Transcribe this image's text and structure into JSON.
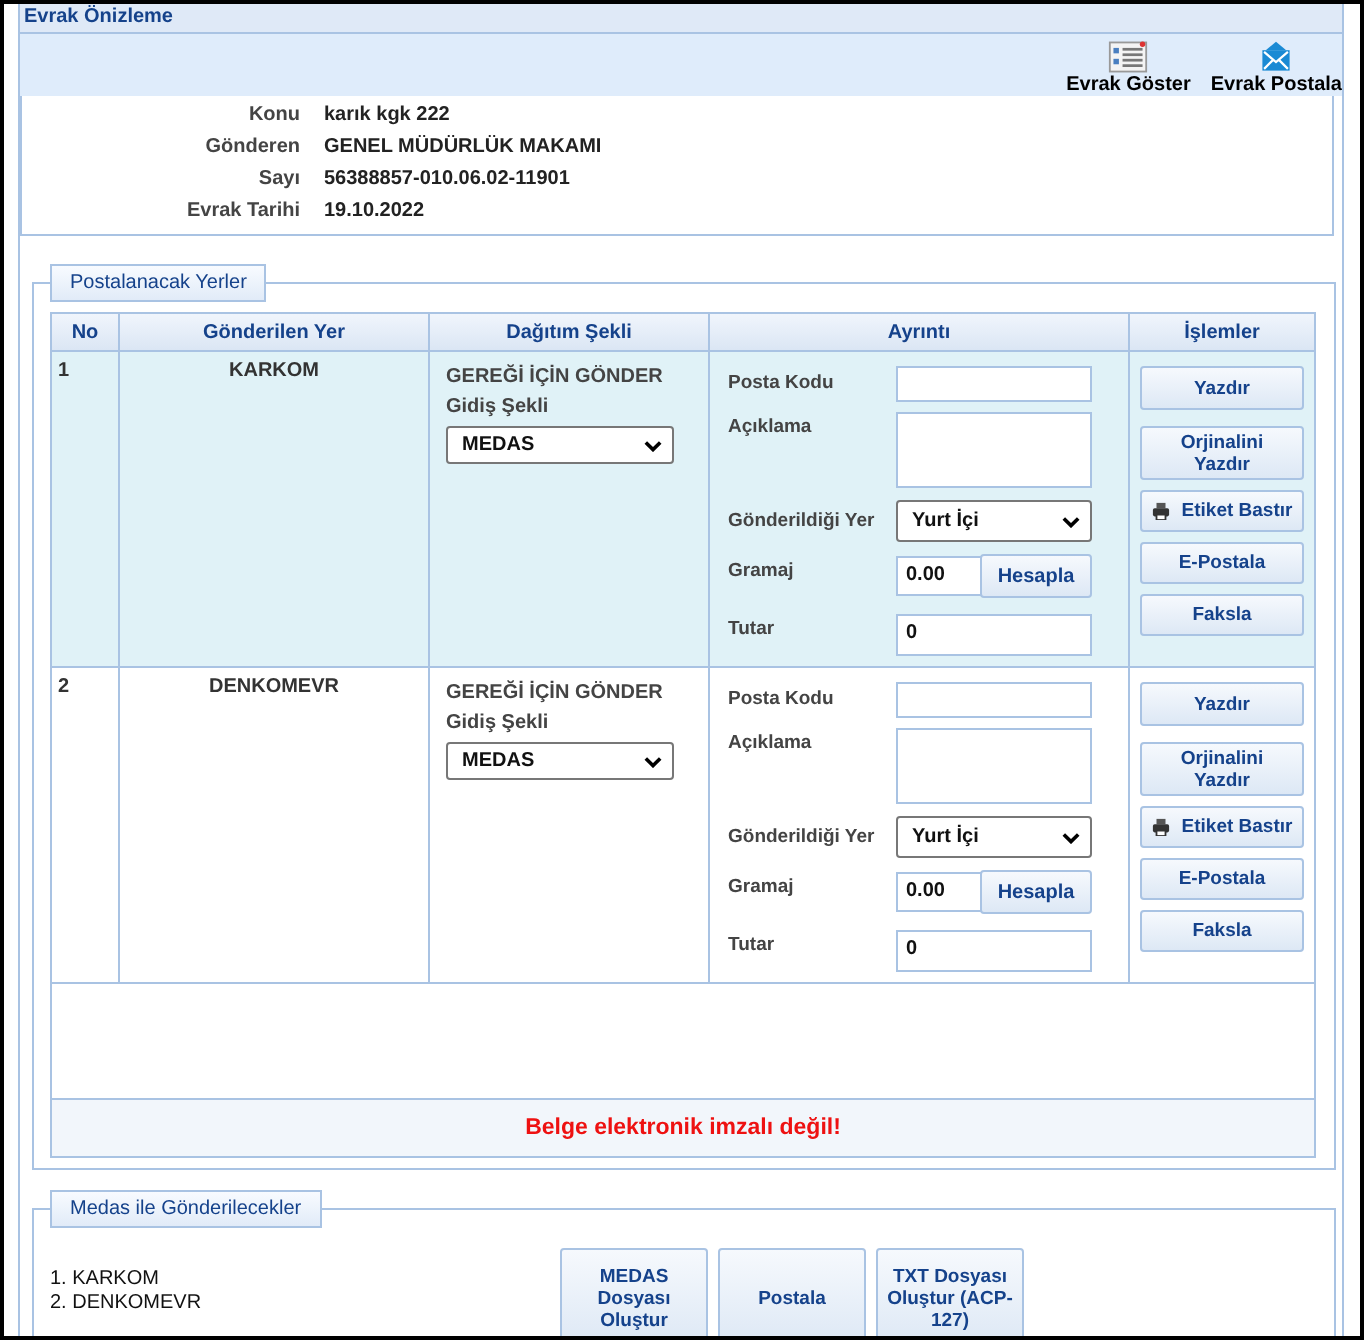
{
  "window": {
    "title": "Evrak Önizleme"
  },
  "toolbar": [
    {
      "label": "Evrak Göster",
      "kind": "list"
    },
    {
      "label": "Evrak Postala",
      "kind": "mail"
    }
  ],
  "info": [
    {
      "label": "Konu",
      "value": "karık kgk 222"
    },
    {
      "label": "Gönderen",
      "value": "GENEL MÜDÜRLÜK MAKAMI"
    },
    {
      "label": "Sayı",
      "value": "56388857-010.06.02-11901"
    },
    {
      "label": "Evrak Tarihi",
      "value": "19.10.2022"
    }
  ],
  "destinations": {
    "legend": "Postalanacak Yerler",
    "columns": [
      "No",
      "Gönderilen Yer",
      "Dağıtım Şekli",
      "Ayrıntı",
      "İşlemler"
    ],
    "rows": [
      {
        "selected": true,
        "no": "1",
        "place": "KARKOM",
        "method": "GEREĞİ İÇİN GÖNDER",
        "route_label": "Gidiş Şekli",
        "route": "MEDAS",
        "details": [
          {
            "kind": "input",
            "label": "Posta Kodu"
          },
          {
            "kind": "textarea",
            "label": "Açıklama"
          },
          {
            "kind": "select",
            "label": "Gönderildiği Yer",
            "value": "Yurt İçi"
          },
          {
            "kind": "calc",
            "label": "Gramaj",
            "value": "0.00",
            "button": "Hesapla"
          },
          {
            "kind": "input",
            "label": "Tutar",
            "value": "0"
          }
        ],
        "actions": [
          {
            "kind": "plain",
            "label": "Yazdır"
          },
          {
            "kind": "plain",
            "label": "Orjinalini Yazdır"
          },
          {
            "kind": "print",
            "label": "Etiket Bastır"
          },
          {
            "kind": "plain",
            "label": "E-Postala"
          },
          {
            "kind": "plain",
            "label": "Faksla"
          }
        ]
      },
      {
        "selected": false,
        "no": "2",
        "place": "DENKOMEVR",
        "method": "GEREĞİ İÇİN GÖNDER",
        "route_label": "Gidiş Şekli",
        "route": "MEDAS",
        "details": [
          {
            "kind": "input",
            "label": "Posta Kodu"
          },
          {
            "kind": "textarea",
            "label": "Açıklama"
          },
          {
            "kind": "select",
            "label": "Gönderildiği Yer",
            "value": "Yurt İçi"
          },
          {
            "kind": "calc",
            "label": "Gramaj",
            "value": "0.00",
            "button": "Hesapla"
          },
          {
            "kind": "input",
            "label": "Tutar",
            "value": "0"
          }
        ],
        "actions": [
          {
            "kind": "plain",
            "label": "Yazdır"
          },
          {
            "kind": "plain",
            "label": "Orjinalini Yazdır"
          },
          {
            "kind": "print",
            "label": "Etiket Bastır"
          },
          {
            "kind": "plain",
            "label": "E-Postala"
          },
          {
            "kind": "plain",
            "label": "Faksla"
          }
        ]
      }
    ],
    "message": "Belge elektronik imzalı değil!"
  },
  "medas": {
    "legend": "Medas ile Gönderilecekler",
    "items": [
      "1. KARKOM",
      "2. DENKOMEVR"
    ],
    "buttons": [
      "MEDAS Dosyası Oluştur",
      "Postala",
      "TXT Dosyası Oluştur (ACP-127)"
    ]
  }
}
